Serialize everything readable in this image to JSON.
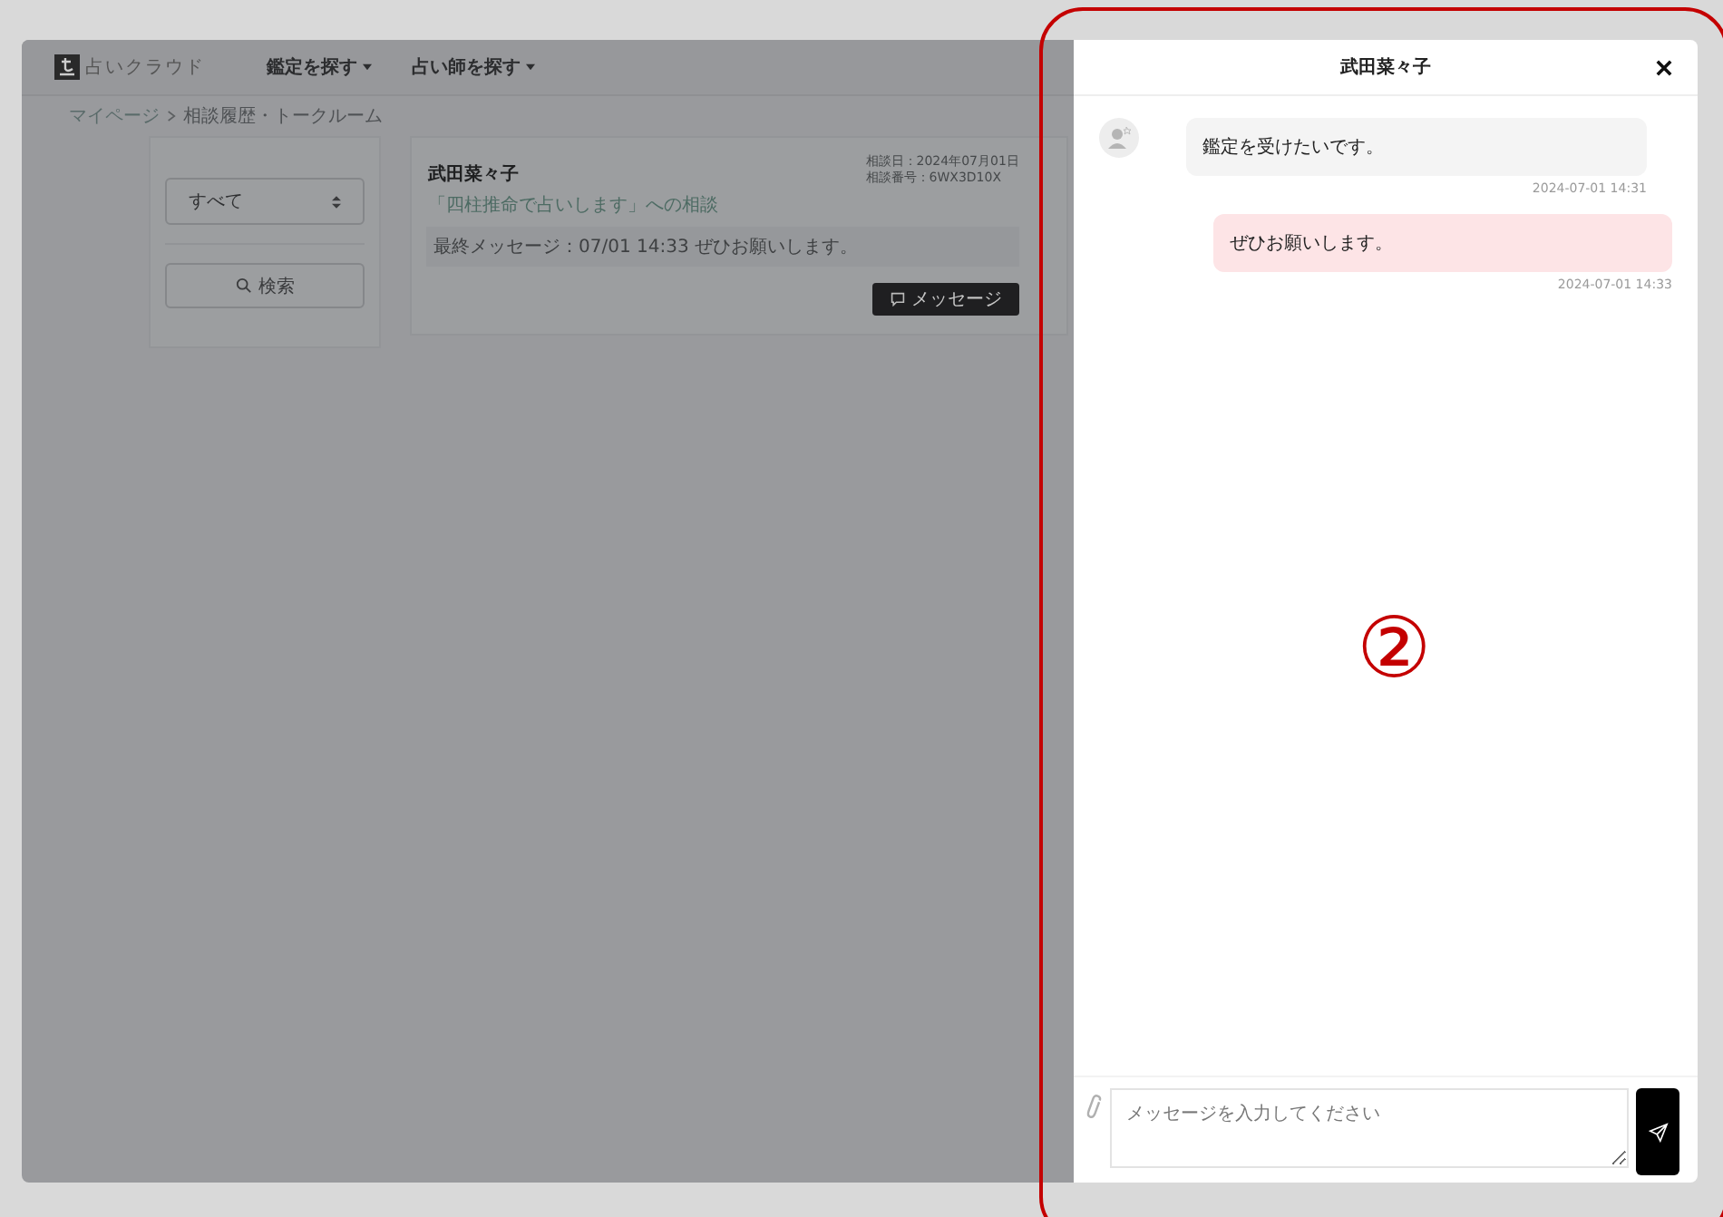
{
  "header": {
    "logo": "占いクラウド",
    "nav": [
      {
        "label": "鑑定を探す"
      },
      {
        "label": "占い師を探す"
      }
    ]
  },
  "breadcrumb": [
    "マイページ",
    "相談履歴・トークルーム"
  ],
  "filter": {
    "select_value": "すべて",
    "search_button": "検索"
  },
  "consultations": [
    {
      "name": "武田菜々子",
      "date": "相談日：2024年07月01日",
      "number": "相談番号：6WX3D10X",
      "topic": "「四柱推命で占いします」への相談",
      "last_message": "最終メッセージ：07/01 14:33 ぜひお願いします。",
      "button": "メッセージ"
    }
  ],
  "chat": {
    "title": "武田菜々子",
    "messages": [
      {
        "kind": "received",
        "text": "鑑定を受けたいです。",
        "time": "2024-07-01 14:31"
      },
      {
        "kind": "sent",
        "text": "ぜひお願いします。",
        "time": "2024-07-01 14:33"
      }
    ],
    "input": {
      "placeholder": "メッセージを入力してください"
    }
  },
  "annotation": {
    "label": "②"
  }
}
